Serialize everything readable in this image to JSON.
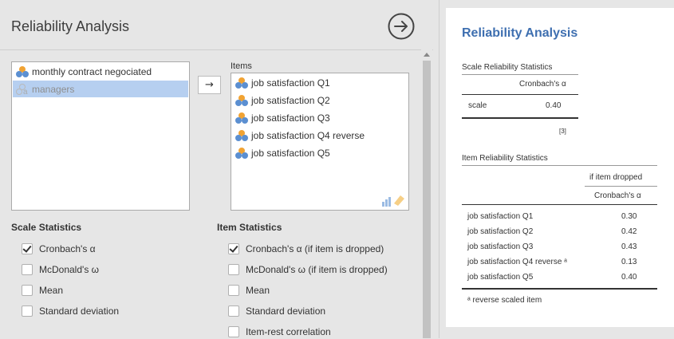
{
  "panel": {
    "title": "Reliability Analysis"
  },
  "variables": [
    {
      "label": "monthly contract negociated",
      "selected": false
    },
    {
      "label": "managers",
      "selected": true
    }
  ],
  "move_button": "→",
  "items_label": "Items",
  "items": [
    {
      "label": "job satisfaction Q1"
    },
    {
      "label": "job satisfaction Q2"
    },
    {
      "label": "job satisfaction Q3"
    },
    {
      "label": "job satisfaction Q4 reverse"
    },
    {
      "label": "job satisfaction Q5"
    }
  ],
  "scale_statistics": {
    "heading": "Scale Statistics",
    "options": [
      {
        "label": "Cronbach's α",
        "checked": true
      },
      {
        "label": "McDonald's ω",
        "checked": false
      },
      {
        "label": "Mean",
        "checked": false
      },
      {
        "label": "Standard deviation",
        "checked": false
      }
    ]
  },
  "item_statistics": {
    "heading": "Item Statistics",
    "options": [
      {
        "label": "Cronbach's α (if item is dropped)",
        "checked": true
      },
      {
        "label": "McDonald's ω (if item is dropped)",
        "checked": false
      },
      {
        "label": "Mean",
        "checked": false
      },
      {
        "label": "Standard deviation",
        "checked": false
      },
      {
        "label": "Item-rest correlation",
        "checked": false
      }
    ]
  },
  "results": {
    "title": "Reliability Analysis",
    "scale_table": {
      "caption": "Scale Reliability Statistics",
      "column": "Cronbach's α",
      "row_label": "scale",
      "value": "0.40",
      "note": "[3]"
    },
    "item_table": {
      "caption": "Item Reliability Statistics",
      "superheader": "if item dropped",
      "column": "Cronbach's α",
      "rows": [
        {
          "label": "job satisfaction Q1",
          "value": "0.30"
        },
        {
          "label": "job satisfaction Q2",
          "value": "0.42"
        },
        {
          "label": "job satisfaction Q3",
          "value": "0.43"
        },
        {
          "label": "job satisfaction Q4 reverse ᵃ",
          "value": "0.13"
        },
        {
          "label": "job satisfaction Q5",
          "value": "0.40"
        }
      ],
      "footnote": "ᵃ reverse scaled item"
    }
  },
  "colors": {
    "accent": "#3e6fb0",
    "selection": "#b6cff0",
    "nominal_icon": "#f1a333",
    "continuous_icon": "#5b8fd1"
  }
}
